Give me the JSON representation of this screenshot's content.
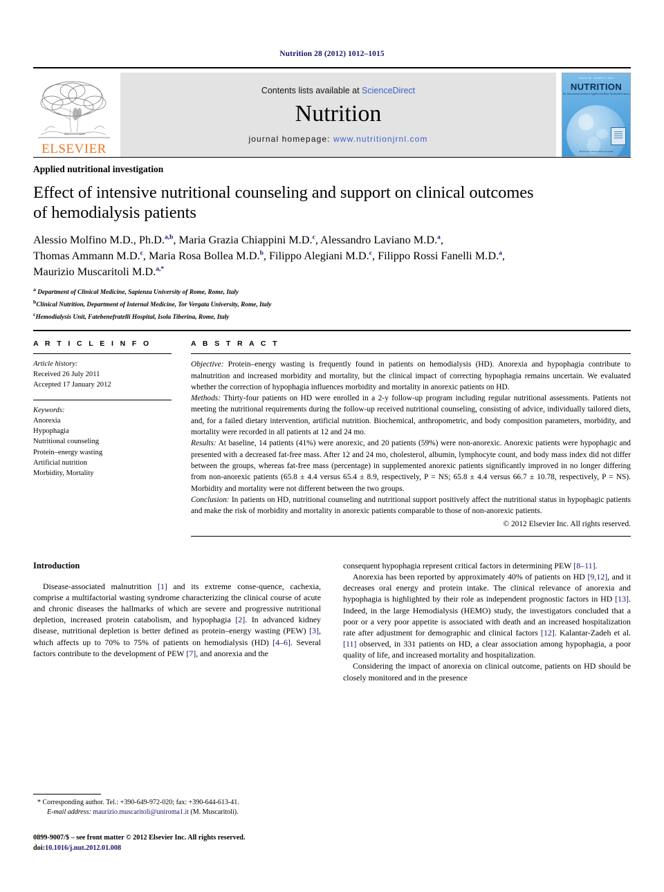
{
  "running_head": "Nutrition 28 (2012) 1012–1015",
  "masthead": {
    "publisher_logo_text": "ELSEVIER",
    "contents_prefix": "Contents lists available at ",
    "contents_link": "ScienceDirect",
    "journal_name": "Nutrition",
    "homepage_prefix": "journal homepage: ",
    "homepage_url": "www.nutritionjrnl.com",
    "cover": {
      "issue_line": "Volume 28 · Number 9 · 2012",
      "title": "NUTRITION",
      "subtitle": "The International Journal of Applied and Basic Nutritional Sciences",
      "footer": "Michael M. Meguid  Editor-in-Chief"
    }
  },
  "article": {
    "kicker": "Applied nutritional investigation",
    "title_line1": "Effect of intensive nutritional counseling and support on clinical outcomes",
    "title_line2": "of hemodialysis patients",
    "authors_line1_a": "Alessio Molfino M.D., Ph.D.",
    "authors_line1_a_sup": "a,b",
    "authors_line1_b": ", Maria Grazia Chiappini M.D.",
    "authors_line1_b_sup": "c",
    "authors_line1_c": ", Alessandro Laviano M.D.",
    "authors_line1_c_sup": "a",
    "authors_line1_d": ",",
    "authors_line2_a": "Thomas Ammann M.D.",
    "authors_line2_a_sup": "c",
    "authors_line2_b": ", Maria Rosa Bollea M.D.",
    "authors_line2_b_sup": "b",
    "authors_line2_c": ", Filippo Alegiani M.D.",
    "authors_line2_c_sup": "c",
    "authors_line2_d": ", Filippo Rossi Fanelli M.D.",
    "authors_line2_d_sup": "a",
    "authors_line2_e": ",",
    "authors_line3_a": "Maurizio Muscaritoli M.D.",
    "authors_line3_a_sup": "a,*",
    "affiliation_a_sup": "a",
    "affiliation_a": " Department of Clinical Medicine, Sapienza University of Rome, Rome, Italy",
    "affiliation_b_sup": "b",
    "affiliation_b": "Clinical Nutrition, Department of Internal Medicine, Tor Vergata University, Rome, Italy",
    "affiliation_c_sup": "c",
    "affiliation_c": "Hemodialysis Unit, Fatebenefratelli Hospital, Isola Tiberina, Rome, Italy"
  },
  "article_info": {
    "heading": "A R T I C L E  I N F O",
    "history_label": "Article history:",
    "received": "Received 26 July 2011",
    "accepted": "Accepted 17 January 2012",
    "keywords_label": "Keywords:",
    "keywords": [
      "Anorexia",
      "Hypophagia",
      "Nutritional counseling",
      "Protein–energy wasting",
      "Artificial nutrition",
      "Morbidity, Mortality"
    ]
  },
  "abstract": {
    "heading": "A B S T R A C T",
    "objective_label": "Objective:",
    "objective_text": " Protein–energy wasting is frequently found in patients on hemodialysis (HD). Anorexia and hypophagia contribute to malnutrition and increased morbidity and mortality, but the clinical impact of correcting hypophagia remains uncertain. We evaluated whether the correction of hypophagia influences morbidity and mortality in anorexic patients on HD.",
    "methods_label": "Methods:",
    "methods_text": " Thirty-four patients on HD were enrolled in a 2-y follow-up program including regular nutritional assessments. Patients not meeting the nutritional requirements during the follow-up received nutritional counseling, consisting of advice, individually tailored diets, and, for a failed dietary intervention, artificial nutrition. Biochemical, anthropometric, and body composition parameters, morbidity, and mortality were recorded in all patients at 12 and 24 mo.",
    "results_label": "Results:",
    "results_text": " At baseline, 14 patients (41%) were anorexic, and 20 patients (59%) were non-anorexic. Anorexic patients were hypophagic and presented with a decreased fat-free mass. After 12 and 24 mo, cholesterol, albumin, lymphocyte count, and body mass index did not differ between the groups, whereas fat-free mass (percentage) in supplemented anorexic patients significantly improved in no longer differing from non-anorexic patients (65.8 ± 4.4 versus 65.4 ± 8.9, respectively, P = NS; 65.8 ± 4.4 versus 66.7 ± 10.78, respectively, P = NS). Morbidity and mortality were not different between the two groups.",
    "conclusion_label": "Conclusion:",
    "conclusion_text": " In patients on HD, nutritional counseling and nutritional support positively affect the nutritional status in hypophagic patients and make the risk of morbidity and mortality in anorexic patients comparable to those of non-anorexic patients.",
    "copyright": "© 2012 Elsevier Inc. All rights reserved."
  },
  "introduction": {
    "heading": "Introduction",
    "left_p1_a": "Disease-associated malnutrition ",
    "left_p1_r1": "[1]",
    "left_p1_b": " and its extreme conse-quence, cachexia, comprise a multifactorial wasting syndrome characterizing the clinical course of acute and chronic diseases the hallmarks of which are severe and progressive nutritional depletion, increased protein catabolism, and hypophagia ",
    "left_p1_r2": "[2]",
    "left_p1_c": ". In advanced kidney disease, nutritional depletion is better defined as protein–energy wasting (PEW) ",
    "left_p1_r3": "[3]",
    "left_p1_d": ", which affects up to 70% to 75% of patients on hemodialysis (HD) ",
    "left_p1_r4": "[4–6]",
    "left_p1_e": ". Several factors contribute to the development of PEW ",
    "left_p1_r5": "[7]",
    "left_p1_f": ", and anorexia and the",
    "right_p1_a": "consequent hypophagia represent critical factors in determining PEW ",
    "right_p1_r1": "[8–11]",
    "right_p1_b": ".",
    "right_p2_a": "Anorexia has been reported by approximately 40% of patients on HD ",
    "right_p2_r1": "[9,12]",
    "right_p2_b": ", and it decreases oral energy and protein intake. The clinical relevance of anorexia and hypophagia is highlighted by their role as independent prognostic factors in HD ",
    "right_p2_r2": "[13]",
    "right_p2_c": ". Indeed, in the large Hemodialysis (HEMO) study, the investigators concluded that a poor or a very poor appetite is associated with death and an increased hospitalization rate after adjustment for demographic and clinical factors ",
    "right_p2_r3": "[12]",
    "right_p2_d": ". Kalantar-Zadeh et al. ",
    "right_p2_r4": "[11]",
    "right_p2_e": " observed, in 331 patients on HD, a clear association among hypophagia, a poor quality of life, and increased mortality and hospitalization.",
    "right_p3": "Considering the impact of anorexia on clinical outcome, patients on HD should be closely monitored and in the presence"
  },
  "footnotes": {
    "corresponding": "* Corresponding author. Tel.: +390-649-972-020; fax: +390-644-613-41.",
    "email_label": "E-mail address:",
    "email": " maurizio.muscaritoli@uniroma1.it",
    "email_suffix": " (M. Muscaritoli).",
    "issn_line": "0899-9007/$ – see front matter © 2012 Elsevier Inc. All rights reserved.",
    "doi_label": "doi:",
    "doi_value": "10.1016/j.nut.2012.01.008"
  }
}
